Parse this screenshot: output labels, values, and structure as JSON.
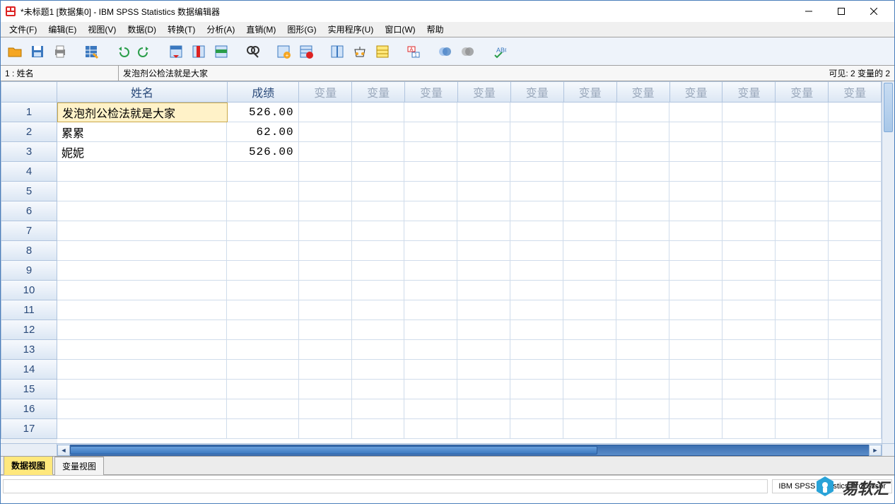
{
  "window": {
    "title": "*未标题1 [数据集0] - IBM SPSS Statistics 数据编辑器"
  },
  "menubar": {
    "items": [
      "文件(F)",
      "编辑(E)",
      "视图(V)",
      "数据(D)",
      "转换(T)",
      "分析(A)",
      "直销(M)",
      "图形(G)",
      "实用程序(U)",
      "窗口(W)",
      "帮助"
    ]
  },
  "toolbar_icons": [
    "open",
    "save",
    "print",
    "data",
    "undo",
    "redo",
    "goto",
    "vars",
    "cases",
    "find",
    "insert-case",
    "insert-var",
    "split",
    "weight",
    "select",
    "value-labels",
    "sets",
    "sets2",
    "spell"
  ],
  "cellbar": {
    "name": "1 : 姓名",
    "value": "发泡剂公检法就是大家",
    "visible": "可见: 2 变量的 2"
  },
  "columns": [
    {
      "label": "姓名",
      "width": "col-name",
      "dim": false
    },
    {
      "label": "成绩",
      "width": "col-score",
      "dim": false
    },
    {
      "label": "变量",
      "width": "col-var",
      "dim": true
    },
    {
      "label": "变量",
      "width": "col-var",
      "dim": true
    },
    {
      "label": "变量",
      "width": "col-var",
      "dim": true
    },
    {
      "label": "变量",
      "width": "col-var",
      "dim": true
    },
    {
      "label": "变量",
      "width": "col-var",
      "dim": true
    },
    {
      "label": "变量",
      "width": "col-var",
      "dim": true
    },
    {
      "label": "变量",
      "width": "col-var",
      "dim": true
    },
    {
      "label": "变量",
      "width": "col-var",
      "dim": true
    },
    {
      "label": "变量",
      "width": "col-var",
      "dim": true
    },
    {
      "label": "变量",
      "width": "col-var",
      "dim": true
    },
    {
      "label": "变量",
      "width": "col-var",
      "dim": true
    }
  ],
  "rows": [
    {
      "name": "发泡剂公检法就是大家",
      "score": "526.00",
      "selected": true
    },
    {
      "name": "累累",
      "score": "62.00",
      "selected": false
    },
    {
      "name": "妮妮",
      "score": "526.00",
      "selected": false
    }
  ],
  "empty_rows": 14,
  "tabs": {
    "data_view": "数据视图",
    "variable_view": "变量视图"
  },
  "statusbar": {
    "processor": "IBM SPSS Statistics Processor"
  },
  "watermark": "易软汇"
}
